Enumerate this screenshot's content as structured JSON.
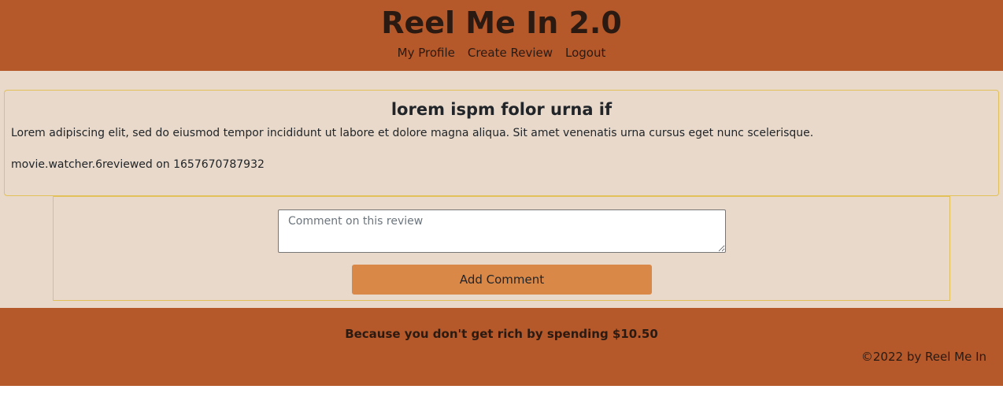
{
  "header": {
    "title": "Reel Me In 2.0",
    "nav": [
      "My Profile",
      "Create Review",
      "Logout"
    ]
  },
  "review": {
    "title": "lorem ispm folor urna if",
    "body": "Lorem adipiscing elit, sed do eiusmod tempor incididunt ut labore et dolore magna aliqua. Sit amet venenatis urna cursus eget nunc scelerisque.",
    "meta": "movie.watcher.6reviewed on 1657670787932"
  },
  "comment": {
    "placeholder": "Comment on this review",
    "value": "",
    "button_label": "Add Comment"
  },
  "footer": {
    "tagline": "Because you don't get rich by spending $10.50",
    "copyright": "©2022 by Reel Me In"
  },
  "colors": {
    "brand": "#b5582a",
    "background": "#e8d9ca",
    "accent_button": "#da8847",
    "card_border": "#e2c15b"
  }
}
